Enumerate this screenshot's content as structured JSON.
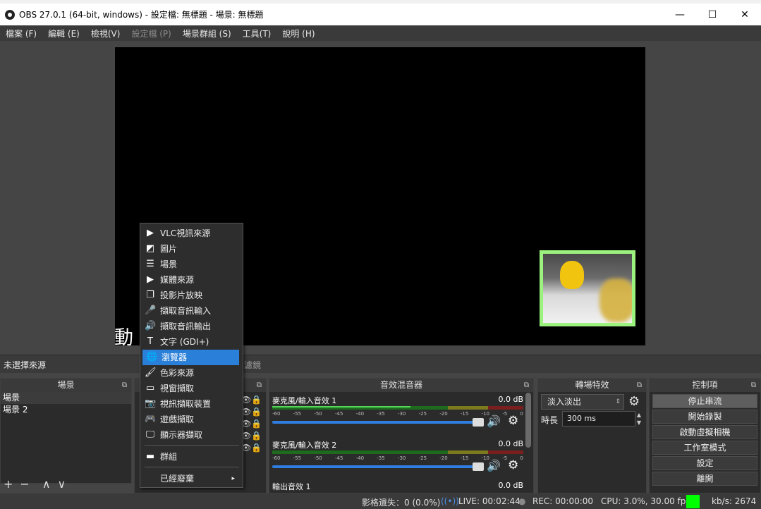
{
  "window": {
    "title": "OBS 27.0.1 (64-bit, windows) - 設定檔: 無標題 - 場景: 無標題",
    "minimize": "—",
    "maximize": "☐",
    "close": "✕"
  },
  "menubar": [
    "檔案 (F)",
    "編輯 (E)",
    "檢視(V)",
    "設定檔 (P)",
    "場景群組 (S)",
    "工具(T)",
    "說明 (H)"
  ],
  "preview": {
    "watermark": "動"
  },
  "source_bar": {
    "no_source": "未選擇來源",
    "filters": "濾鏡"
  },
  "scenes": {
    "title": "場景",
    "items": [
      "場景",
      "場景 2"
    ],
    "add": "+",
    "remove": "−",
    "up": "∧",
    "down": "∨"
  },
  "context_menu": {
    "items": [
      {
        "label": "VLC視訊來源",
        "icon": "play-icon",
        "glyph": "▶"
      },
      {
        "label": "圖片",
        "icon": "image-icon",
        "glyph": "◩"
      },
      {
        "label": "場景",
        "icon": "list-icon",
        "glyph": "☰"
      },
      {
        "label": "媒體來源",
        "icon": "play-icon",
        "glyph": "▶"
      },
      {
        "label": "投影片放映",
        "icon": "slideshow-icon",
        "glyph": "❐"
      },
      {
        "label": "擷取音訊輸入",
        "icon": "microphone-icon",
        "glyph": "🎤"
      },
      {
        "label": "擷取音訊輸出",
        "icon": "speaker-icon",
        "glyph": "🔊"
      },
      {
        "label": "文字 (GDI+)",
        "icon": "text-icon",
        "glyph": "T"
      },
      {
        "label": "瀏覽器",
        "icon": "globe-icon",
        "glyph": "🌐"
      },
      {
        "label": "色彩來源",
        "icon": "brush-icon",
        "glyph": "🖌"
      },
      {
        "label": "視窗擷取",
        "icon": "window-icon",
        "glyph": "▭"
      },
      {
        "label": "視訊擷取裝置",
        "icon": "camera-icon",
        "glyph": "📷"
      },
      {
        "label": "遊戲擷取",
        "icon": "gamepad-icon",
        "glyph": "🎮"
      },
      {
        "label": "顯示器擷取",
        "icon": "monitor-icon",
        "glyph": "🖵"
      },
      {
        "label": "群組",
        "icon": "folder-icon",
        "glyph": "▬"
      },
      {
        "label": "已經廢棄",
        "icon": "",
        "glyph": ""
      }
    ],
    "selected": "瀏覽器",
    "submenu_arrow": "▸"
  },
  "mixer": {
    "title": "音效混音器",
    "channels": [
      {
        "name": "麥克風/輸入音效 1",
        "db": "0.0 dB",
        "level": 0.55
      },
      {
        "name": "麥克風/輸入音效 2",
        "db": "0.0 dB",
        "level": 0.0
      },
      {
        "name": "輸出音效 1",
        "db": "0.0 dB",
        "level": 0.0
      }
    ],
    "scale": [
      "-60",
      "-55",
      "-50",
      "-45",
      "-40",
      "-35",
      "-30",
      "-25",
      "-20",
      "-15",
      "-10",
      "-5",
      "0"
    ]
  },
  "transitions": {
    "title": "轉場特效",
    "selected": "淡入淡出",
    "duration_label": "時長",
    "duration": "300 ms"
  },
  "controls": {
    "title": "控制項",
    "buttons": [
      "停止串流",
      "開始錄製",
      "啟動虛擬相機",
      "工作室模式",
      "設定",
      "離開"
    ]
  },
  "status": {
    "dropped": "影格遺失：0 (0.0%)",
    "live": "LIVE: 00:02:44",
    "rec": "REC: 00:00:00",
    "cpu": "CPU: 3.0%, 30.00 fps",
    "kbs": "kb/s: 2674",
    "indicator_color": "#00ff00"
  }
}
